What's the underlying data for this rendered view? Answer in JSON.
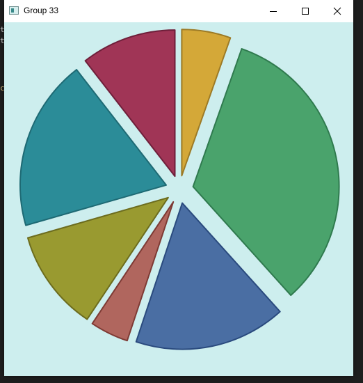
{
  "window": {
    "title": "Group 33",
    "background": "#cdeeee"
  },
  "controls": {
    "minimize_icon": "minimize-icon",
    "maximize_icon": "maximize-icon",
    "close_icon": "close-icon"
  },
  "chart_data": {
    "type": "pie",
    "title": "",
    "exploded": true,
    "start_angle_deg": 90,
    "direction": "clockwise",
    "values": [
      5.6,
      34.1,
      17.4,
      4.4,
      11.6,
      19.6,
      10.9
    ],
    "colors": [
      "#d4a838",
      "#4aa36c",
      "#4a6ea3",
      "#b0665e",
      "#999a30",
      "#2b8c98",
      "#a03556"
    ],
    "edge_colors": [
      "#9c7a26",
      "#2f7a4e",
      "#2a4a7e",
      "#7e3a34",
      "#6c6c1e",
      "#1e6a74",
      "#6e1f3a"
    ]
  }
}
